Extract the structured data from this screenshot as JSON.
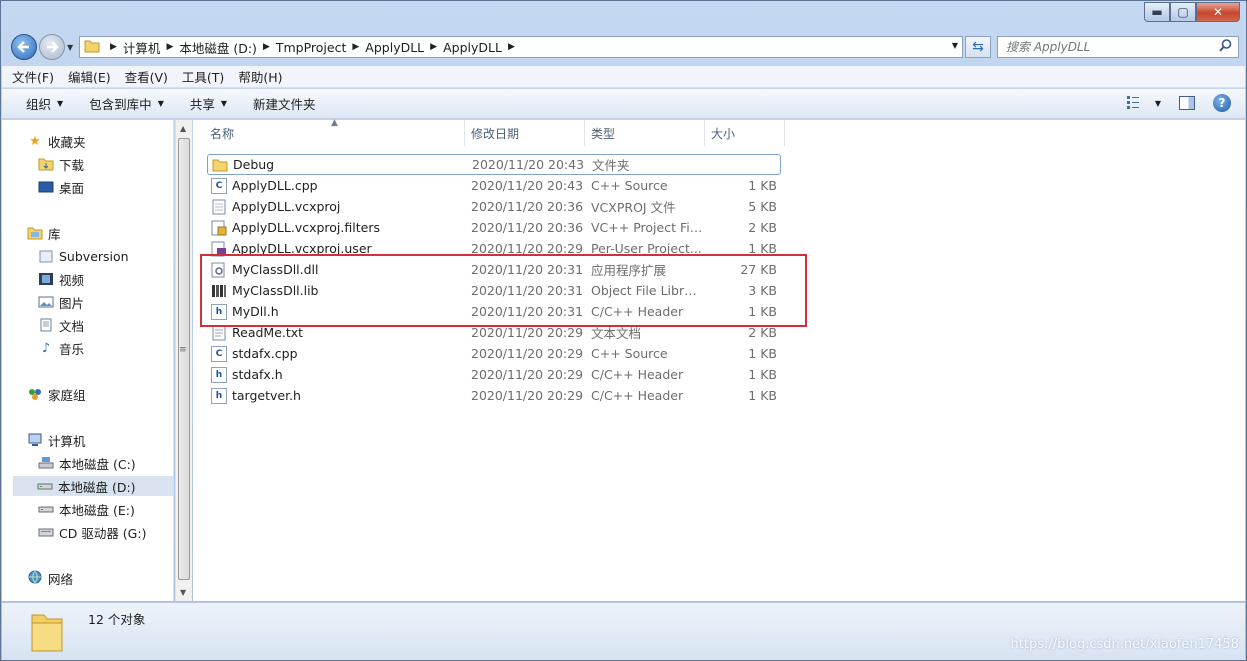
{
  "window": {
    "controls": {
      "minimize": "▬",
      "maximize": "▢",
      "close": "✕"
    }
  },
  "address": {
    "crumbs": [
      "计算机",
      "本地磁盘 (D:)",
      "TmpProject",
      "ApplyDLL",
      "ApplyDLL"
    ],
    "search_placeholder": "搜索 ApplyDLL"
  },
  "menubar": [
    "文件(F)",
    "编辑(E)",
    "查看(V)",
    "工具(T)",
    "帮助(H)"
  ],
  "toolbar": {
    "organize": "组织",
    "include_in_library": "包含到库中",
    "share": "共享",
    "new_folder": "新建文件夹"
  },
  "nav": {
    "favorites": "收藏夹",
    "downloads": "下载",
    "desktop": "桌面",
    "libraries": "库",
    "subversion": "Subversion",
    "videos": "视频",
    "pictures": "图片",
    "documents": "文档",
    "music": "音乐",
    "homegroup": "家庭组",
    "computer": "计算机",
    "drive_c": "本地磁盘 (C:)",
    "drive_d": "本地磁盘 (D:)",
    "drive_e": "本地磁盘 (E:)",
    "drive_g": "CD 驱动器 (G:)",
    "network": "网络"
  },
  "columns": {
    "name": "名称",
    "date": "修改日期",
    "type": "类型",
    "size": "大小"
  },
  "files": [
    {
      "name": "Debug",
      "date": "2020/11/20 20:43",
      "type": "文件夹",
      "size": "",
      "icon": "folder-icon"
    },
    {
      "name": "ApplyDLL.cpp",
      "date": "2020/11/20 20:43",
      "type": "C++ Source",
      "size": "1 KB",
      "icon": "cpp-file-icon"
    },
    {
      "name": "ApplyDLL.vcxproj",
      "date": "2020/11/20 20:36",
      "type": "VCXPROJ 文件",
      "size": "5 KB",
      "icon": "document-icon"
    },
    {
      "name": "ApplyDLL.vcxproj.filters",
      "date": "2020/11/20 20:36",
      "type": "VC++ Project Fil...",
      "size": "2 KB",
      "icon": "vc-project-icon"
    },
    {
      "name": "ApplyDLL.vcxproj.user",
      "date": "2020/11/20 20:29",
      "type": "Per-User Project...",
      "size": "1 KB",
      "icon": "user-project-icon"
    },
    {
      "name": "MyClassDll.dll",
      "date": "2020/11/20 20:31",
      "type": "应用程序扩展",
      "size": "27 KB",
      "icon": "dll-icon"
    },
    {
      "name": "MyClassDll.lib",
      "date": "2020/11/20 20:31",
      "type": "Object File Library",
      "size": "3 KB",
      "icon": "lib-icon"
    },
    {
      "name": "MyDll.h",
      "date": "2020/11/20 20:31",
      "type": "C/C++ Header",
      "size": "1 KB",
      "icon": "header-file-icon"
    },
    {
      "name": "ReadMe.txt",
      "date": "2020/11/20 20:29",
      "type": "文本文档",
      "size": "2 KB",
      "icon": "text-file-icon"
    },
    {
      "name": "stdafx.cpp",
      "date": "2020/11/20 20:29",
      "type": "C++ Source",
      "size": "1 KB",
      "icon": "cpp-file-icon"
    },
    {
      "name": "stdafx.h",
      "date": "2020/11/20 20:29",
      "type": "C/C++ Header",
      "size": "1 KB",
      "icon": "header-file-icon"
    },
    {
      "name": "targetver.h",
      "date": "2020/11/20 20:29",
      "type": "C/C++ Header",
      "size": "1 KB",
      "icon": "header-file-icon"
    }
  ],
  "status": {
    "count": "12 个对象"
  },
  "watermark": "https://blog.csdn.net/xiaofen17458"
}
